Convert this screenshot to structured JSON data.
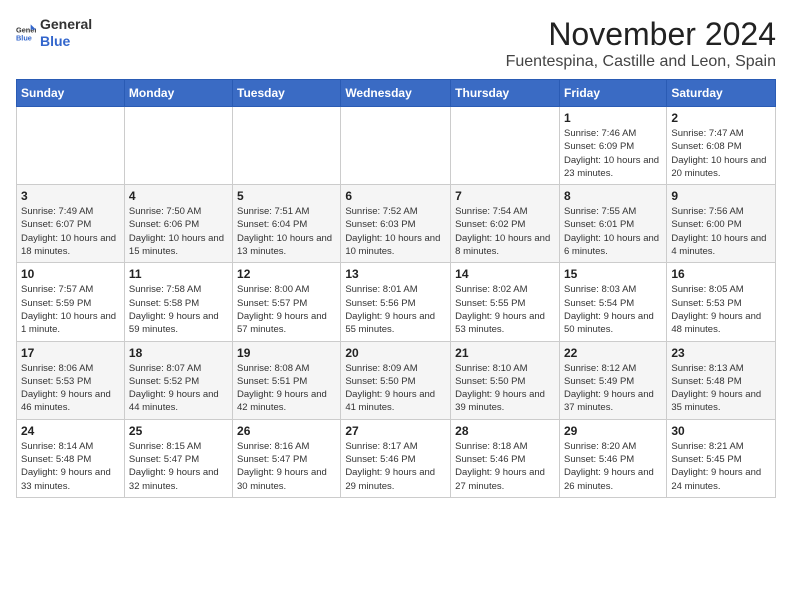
{
  "logo": {
    "general": "General",
    "blue": "Blue"
  },
  "title": "November 2024",
  "location": "Fuentespina, Castille and Leon, Spain",
  "weekdays": [
    "Sunday",
    "Monday",
    "Tuesday",
    "Wednesday",
    "Thursday",
    "Friday",
    "Saturday"
  ],
  "weeks": [
    [
      {
        "day": "",
        "info": ""
      },
      {
        "day": "",
        "info": ""
      },
      {
        "day": "",
        "info": ""
      },
      {
        "day": "",
        "info": ""
      },
      {
        "day": "",
        "info": ""
      },
      {
        "day": "1",
        "info": "Sunrise: 7:46 AM\nSunset: 6:09 PM\nDaylight: 10 hours and 23 minutes."
      },
      {
        "day": "2",
        "info": "Sunrise: 7:47 AM\nSunset: 6:08 PM\nDaylight: 10 hours and 20 minutes."
      }
    ],
    [
      {
        "day": "3",
        "info": "Sunrise: 7:49 AM\nSunset: 6:07 PM\nDaylight: 10 hours and 18 minutes."
      },
      {
        "day": "4",
        "info": "Sunrise: 7:50 AM\nSunset: 6:06 PM\nDaylight: 10 hours and 15 minutes."
      },
      {
        "day": "5",
        "info": "Sunrise: 7:51 AM\nSunset: 6:04 PM\nDaylight: 10 hours and 13 minutes."
      },
      {
        "day": "6",
        "info": "Sunrise: 7:52 AM\nSunset: 6:03 PM\nDaylight: 10 hours and 10 minutes."
      },
      {
        "day": "7",
        "info": "Sunrise: 7:54 AM\nSunset: 6:02 PM\nDaylight: 10 hours and 8 minutes."
      },
      {
        "day": "8",
        "info": "Sunrise: 7:55 AM\nSunset: 6:01 PM\nDaylight: 10 hours and 6 minutes."
      },
      {
        "day": "9",
        "info": "Sunrise: 7:56 AM\nSunset: 6:00 PM\nDaylight: 10 hours and 4 minutes."
      }
    ],
    [
      {
        "day": "10",
        "info": "Sunrise: 7:57 AM\nSunset: 5:59 PM\nDaylight: 10 hours and 1 minute."
      },
      {
        "day": "11",
        "info": "Sunrise: 7:58 AM\nSunset: 5:58 PM\nDaylight: 9 hours and 59 minutes."
      },
      {
        "day": "12",
        "info": "Sunrise: 8:00 AM\nSunset: 5:57 PM\nDaylight: 9 hours and 57 minutes."
      },
      {
        "day": "13",
        "info": "Sunrise: 8:01 AM\nSunset: 5:56 PM\nDaylight: 9 hours and 55 minutes."
      },
      {
        "day": "14",
        "info": "Sunrise: 8:02 AM\nSunset: 5:55 PM\nDaylight: 9 hours and 53 minutes."
      },
      {
        "day": "15",
        "info": "Sunrise: 8:03 AM\nSunset: 5:54 PM\nDaylight: 9 hours and 50 minutes."
      },
      {
        "day": "16",
        "info": "Sunrise: 8:05 AM\nSunset: 5:53 PM\nDaylight: 9 hours and 48 minutes."
      }
    ],
    [
      {
        "day": "17",
        "info": "Sunrise: 8:06 AM\nSunset: 5:53 PM\nDaylight: 9 hours and 46 minutes."
      },
      {
        "day": "18",
        "info": "Sunrise: 8:07 AM\nSunset: 5:52 PM\nDaylight: 9 hours and 44 minutes."
      },
      {
        "day": "19",
        "info": "Sunrise: 8:08 AM\nSunset: 5:51 PM\nDaylight: 9 hours and 42 minutes."
      },
      {
        "day": "20",
        "info": "Sunrise: 8:09 AM\nSunset: 5:50 PM\nDaylight: 9 hours and 41 minutes."
      },
      {
        "day": "21",
        "info": "Sunrise: 8:10 AM\nSunset: 5:50 PM\nDaylight: 9 hours and 39 minutes."
      },
      {
        "day": "22",
        "info": "Sunrise: 8:12 AM\nSunset: 5:49 PM\nDaylight: 9 hours and 37 minutes."
      },
      {
        "day": "23",
        "info": "Sunrise: 8:13 AM\nSunset: 5:48 PM\nDaylight: 9 hours and 35 minutes."
      }
    ],
    [
      {
        "day": "24",
        "info": "Sunrise: 8:14 AM\nSunset: 5:48 PM\nDaylight: 9 hours and 33 minutes."
      },
      {
        "day": "25",
        "info": "Sunrise: 8:15 AM\nSunset: 5:47 PM\nDaylight: 9 hours and 32 minutes."
      },
      {
        "day": "26",
        "info": "Sunrise: 8:16 AM\nSunset: 5:47 PM\nDaylight: 9 hours and 30 minutes."
      },
      {
        "day": "27",
        "info": "Sunrise: 8:17 AM\nSunset: 5:46 PM\nDaylight: 9 hours and 29 minutes."
      },
      {
        "day": "28",
        "info": "Sunrise: 8:18 AM\nSunset: 5:46 PM\nDaylight: 9 hours and 27 minutes."
      },
      {
        "day": "29",
        "info": "Sunrise: 8:20 AM\nSunset: 5:46 PM\nDaylight: 9 hours and 26 minutes."
      },
      {
        "day": "30",
        "info": "Sunrise: 8:21 AM\nSunset: 5:45 PM\nDaylight: 9 hours and 24 minutes."
      }
    ]
  ]
}
